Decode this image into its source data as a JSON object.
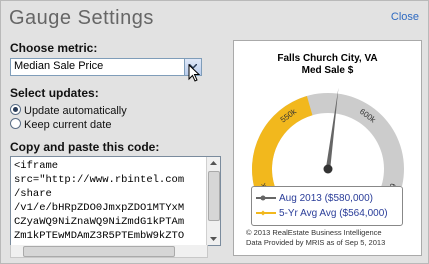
{
  "dialog": {
    "title": "Gauge Settings",
    "close_label": "Close"
  },
  "metric": {
    "label": "Choose metric:",
    "selected": "Median Sale Price"
  },
  "updates": {
    "label": "Select updates:",
    "options": [
      {
        "label": "Update automatically",
        "selected": true
      },
      {
        "label": "Keep current date",
        "selected": false
      }
    ]
  },
  "code": {
    "label": "Copy and paste this code:",
    "text": "<iframe\nsrc=\"http://www.rbintel.com\n/share\n/v1/e/bHRpZDO0JmxpZDO1MTYxM\nCZyaWQ9NiZnaWQ9NiZmdG1kPTAm\nZm1kPTEwMDAmZ3R5PTEmbW9kZTO"
  },
  "gauge": {
    "place": "Falls Church City, VA",
    "metric_short": "Med Sale $",
    "ticks": [
      "500k",
      "550k",
      "600k",
      "650k"
    ],
    "min": 500000,
    "max": 650000,
    "current_value": 580000,
    "avg_value": 564000,
    "colors": {
      "track": "#cccccc",
      "avg_band": "#f2b81d",
      "needle": "#666666"
    },
    "legend": [
      {
        "label": "Aug 2013 ($580,000)",
        "color": "#666666",
        "text_color": "#2a3d99"
      },
      {
        "label": "5-Yr Avg Avg ($564,000)",
        "color": "#f2b81d",
        "text_color": "#2a3d99"
      }
    ],
    "footer_line1": "© 2013 RealEstate Business Intelligence",
    "footer_line2": "Data Provided by MRIS as of Sep 5, 2013"
  }
}
